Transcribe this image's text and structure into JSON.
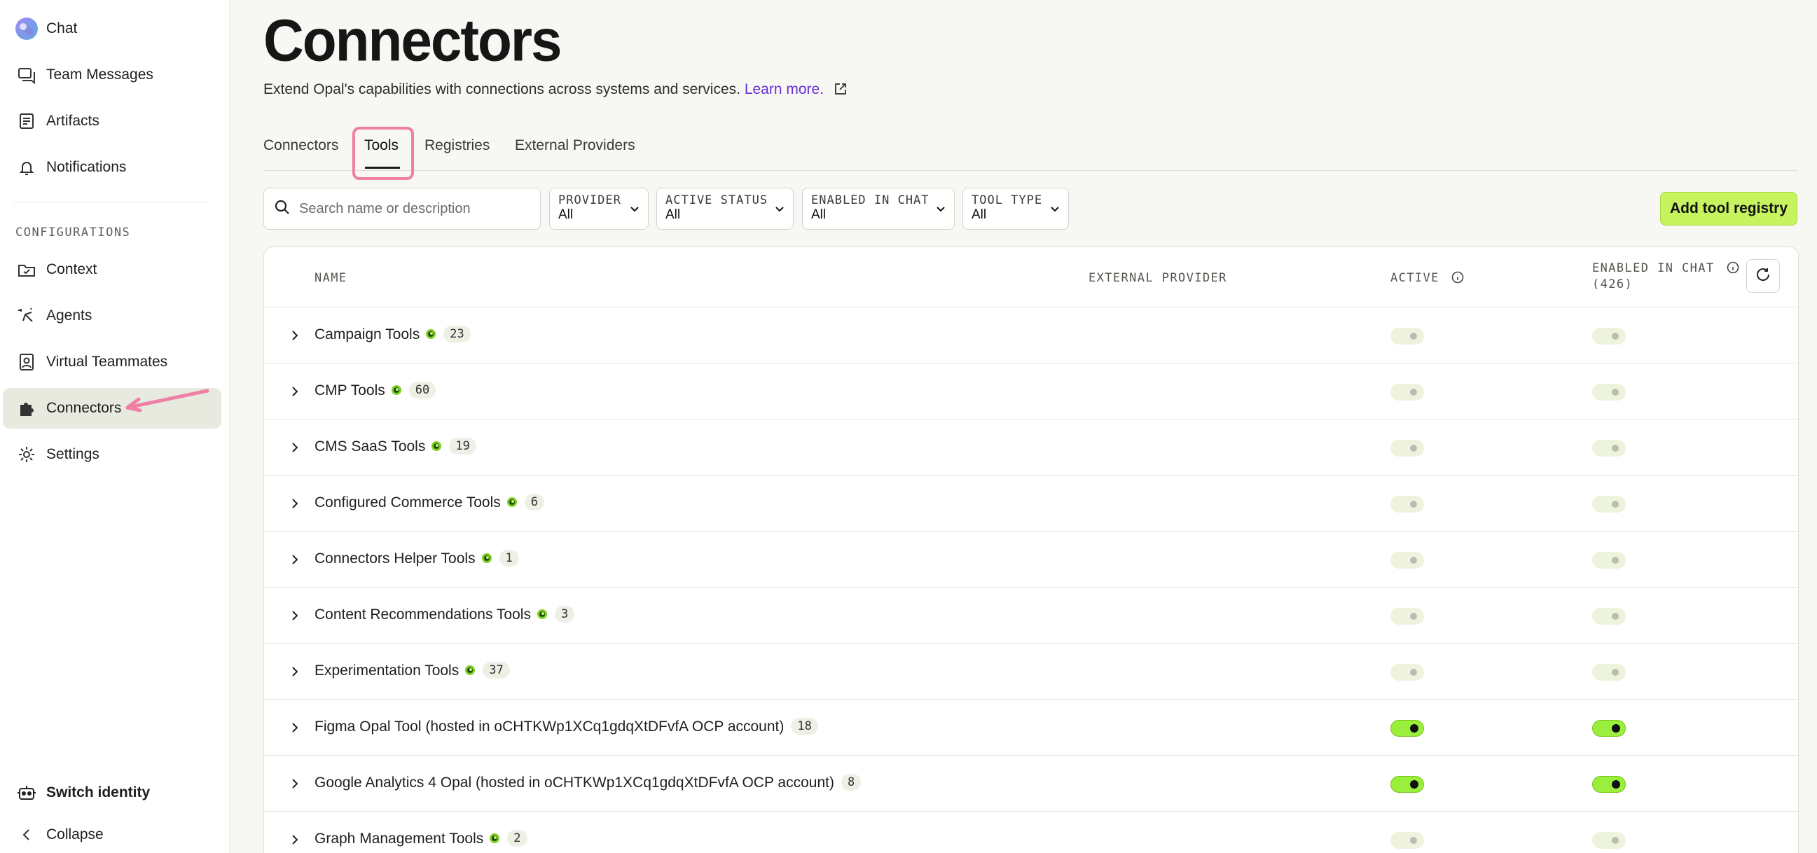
{
  "sidebar": {
    "top_items": [
      {
        "label": "Chat",
        "icon": "chat-logo-icon"
      },
      {
        "label": "Team Messages",
        "icon": "messages-icon"
      },
      {
        "label": "Artifacts",
        "icon": "artifacts-icon"
      },
      {
        "label": "Notifications",
        "icon": "bell-icon"
      }
    ],
    "section_label": "CONFIGURATIONS",
    "config_items": [
      {
        "label": "Context",
        "icon": "folder-icon"
      },
      {
        "label": "Agents",
        "icon": "agents-icon"
      },
      {
        "label": "Virtual Teammates",
        "icon": "teammate-icon"
      },
      {
        "label": "Connectors",
        "icon": "puzzle-icon",
        "active": true
      },
      {
        "label": "Settings",
        "icon": "gear-icon"
      }
    ],
    "switch_identity": "Switch identity",
    "collapse": "Collapse"
  },
  "header": {
    "title": "Connectors",
    "subtitle": "Extend Opal's capabilities with connections across systems and services.",
    "learn_more": "Learn more."
  },
  "tabs": [
    {
      "label": "Connectors"
    },
    {
      "label": "Tools",
      "active": true
    },
    {
      "label": "Registries"
    },
    {
      "label": "External Providers"
    }
  ],
  "filters": {
    "search_placeholder": "Search name or description",
    "provider": {
      "label": "PROVIDER",
      "value": "All"
    },
    "active_status": {
      "label": "ACTIVE STATUS",
      "value": "All"
    },
    "enabled_in_chat": {
      "label": "ENABLED IN CHAT",
      "value": "All"
    },
    "tool_type": {
      "label": "TOOL TYPE",
      "value": "All"
    },
    "add_button": "Add tool registry"
  },
  "table": {
    "columns": {
      "name": "NAME",
      "external_provider": "EXTERNAL PROVIDER",
      "active": "ACTIVE",
      "enabled_in_chat": "ENABLED IN CHAT",
      "enabled_count": "(426)"
    },
    "rows": [
      {
        "name": "Campaign Tools",
        "count": "23",
        "status_dot": true,
        "active": false,
        "enabled": false
      },
      {
        "name": "CMP Tools",
        "count": "60",
        "status_dot": true,
        "active": false,
        "enabled": false
      },
      {
        "name": "CMS SaaS Tools",
        "count": "19",
        "status_dot": true,
        "active": false,
        "enabled": false
      },
      {
        "name": "Configured Commerce Tools",
        "count": "6",
        "status_dot": true,
        "active": false,
        "enabled": false
      },
      {
        "name": "Connectors Helper Tools",
        "count": "1",
        "status_dot": true,
        "active": false,
        "enabled": false
      },
      {
        "name": "Content Recommendations Tools",
        "count": "3",
        "status_dot": true,
        "active": false,
        "enabled": false
      },
      {
        "name": "Experimentation Tools",
        "count": "37",
        "status_dot": true,
        "active": false,
        "enabled": false
      },
      {
        "name": "Figma Opal Tool (hosted in oCHTKWp1XCq1gdqXtDFvfA OCP account)",
        "count": "18",
        "status_dot": false,
        "active": true,
        "enabled": true
      },
      {
        "name": "Google Analytics 4 Opal (hosted in oCHTKWp1XCq1gdqXtDFvfA OCP account)",
        "count": "8",
        "status_dot": false,
        "active": true,
        "enabled": true
      },
      {
        "name": "Graph Management Tools",
        "count": "2",
        "status_dot": true,
        "active": false,
        "enabled": false
      }
    ]
  },
  "colors": {
    "accent_green": "#c6f35e",
    "toggle_on": "#9aee3c",
    "link_purple": "#6a2fd4",
    "annotation_pink": "#ef7fa5"
  }
}
